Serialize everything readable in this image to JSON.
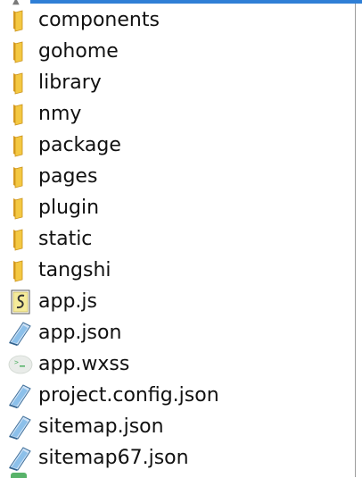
{
  "files": [
    {
      "name": "components",
      "icon": "folder-icon"
    },
    {
      "name": "gohome",
      "icon": "folder-icon"
    },
    {
      "name": "library",
      "icon": "folder-icon"
    },
    {
      "name": "nmy",
      "icon": "folder-icon"
    },
    {
      "name": "package",
      "icon": "folder-icon"
    },
    {
      "name": "pages",
      "icon": "folder-icon"
    },
    {
      "name": "plugin",
      "icon": "folder-icon"
    },
    {
      "name": "static",
      "icon": "folder-icon"
    },
    {
      "name": "tangshi",
      "icon": "folder-icon"
    },
    {
      "name": "app.js",
      "icon": "js-file-icon"
    },
    {
      "name": "app.json",
      "icon": "json-file-icon"
    },
    {
      "name": "app.wxss",
      "icon": "wxss-file-icon"
    },
    {
      "name": "project.config.json",
      "icon": "json-file-icon"
    },
    {
      "name": "sitemap.json",
      "icon": "json-file-icon"
    },
    {
      "name": "sitemap67.json",
      "icon": "json-file-icon"
    }
  ],
  "colors": {
    "folder": "#f4c842",
    "accent": "#2f7fd6",
    "wxss": "#58b36a"
  }
}
